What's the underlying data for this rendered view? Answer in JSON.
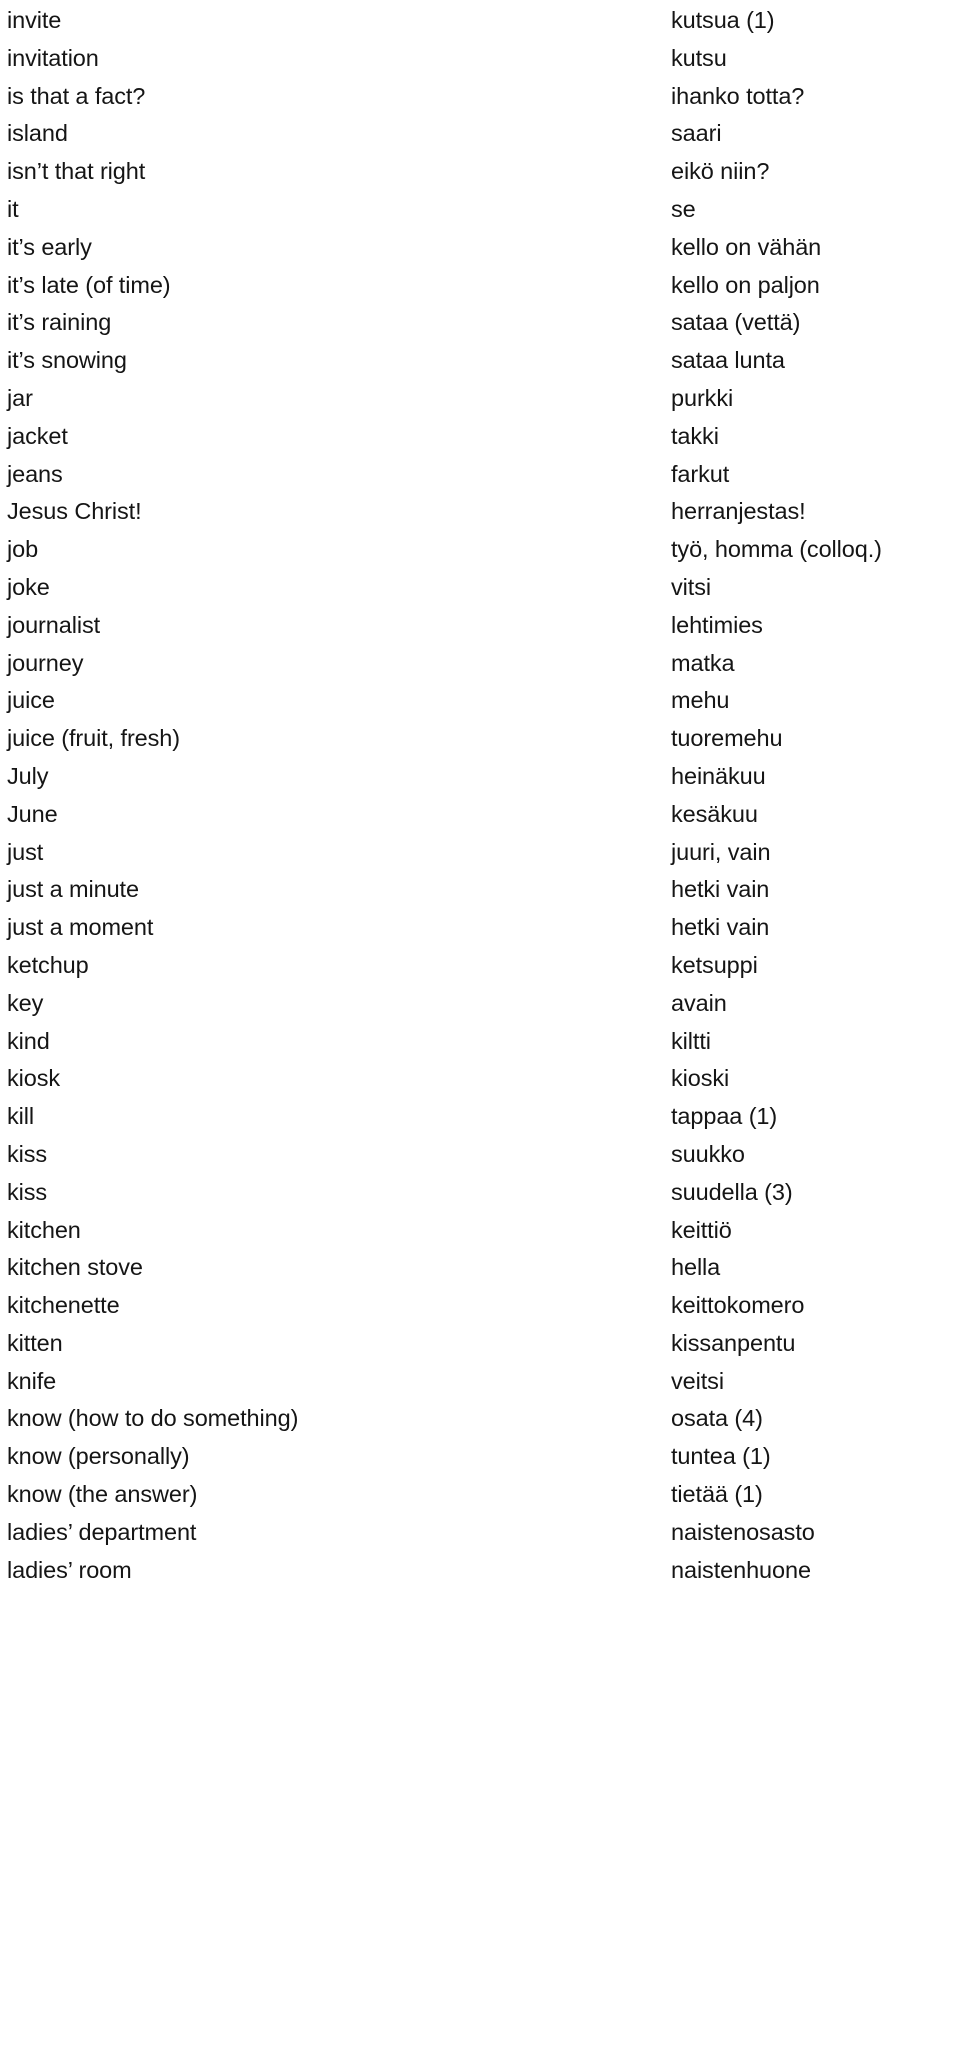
{
  "document": {
    "type": "bilingual-glossary",
    "source_language": "English",
    "target_language": "Finnish",
    "entries": [
      {
        "en": "invite",
        "fi": "kutsua (1)"
      },
      {
        "en": "invitation",
        "fi": "kutsu"
      },
      {
        "en": "is that a fact?",
        "fi": "ihanko totta?"
      },
      {
        "en": "island",
        "fi": "saari"
      },
      {
        "en": "isn’t that right",
        "fi": "eikö niin?"
      },
      {
        "en": "it",
        "fi": "se"
      },
      {
        "en": "it’s early",
        "fi": "kello on vähän"
      },
      {
        "en": "it’s late (of time)",
        "fi": "kello on paljon"
      },
      {
        "en": "it’s raining",
        "fi": "sataa (vettä)"
      },
      {
        "en": "it’s snowing",
        "fi": "sataa lunta"
      },
      {
        "en": "jar",
        "fi": "purkki"
      },
      {
        "en": "jacket",
        "fi": "takki"
      },
      {
        "en": "jeans",
        "fi": "farkut"
      },
      {
        "en": "Jesus Christ!",
        "fi": "herranjestas!"
      },
      {
        "en": "job",
        "fi": "työ, homma (colloq.)"
      },
      {
        "en": "joke",
        "fi": "vitsi"
      },
      {
        "en": "journalist",
        "fi": "lehtimies"
      },
      {
        "en": "journey",
        "fi": "matka"
      },
      {
        "en": "juice",
        "fi": "mehu"
      },
      {
        "en": "juice (fruit, fresh)",
        "fi": "tuoremehu"
      },
      {
        "en": "July",
        "fi": "heinäkuu"
      },
      {
        "en": "June",
        "fi": "kesäkuu"
      },
      {
        "en": "just",
        "fi": "juuri, vain"
      },
      {
        "en": "just a minute",
        "fi": "hetki vain"
      },
      {
        "en": "just a moment",
        "fi": "hetki vain"
      },
      {
        "en": "ketchup",
        "fi": "ketsuppi"
      },
      {
        "en": "key",
        "fi": "avain"
      },
      {
        "en": "kind",
        "fi": "kiltti"
      },
      {
        "en": "kiosk",
        "fi": "kioski"
      },
      {
        "en": "kill",
        "fi": "tappaa (1)"
      },
      {
        "en": "kiss",
        "fi": "suukko"
      },
      {
        "en": "kiss",
        "fi": "suudella (3)"
      },
      {
        "en": "kitchen",
        "fi": "keittiö"
      },
      {
        "en": "kitchen stove",
        "fi": "hella"
      },
      {
        "en": "kitchenette",
        "fi": "keittokomero"
      },
      {
        "en": "kitten",
        "fi": "kissanpentu"
      },
      {
        "en": "knife",
        "fi": "veitsi"
      },
      {
        "en": "know (how to do something)",
        "fi": "osata (4)"
      },
      {
        "en": "know (personally)",
        "fi": "tuntea (1)"
      },
      {
        "en": "know (the answer)",
        "fi": "tietää (1)"
      },
      {
        "en": "ladies’ department",
        "fi": "naistenosasto"
      },
      {
        "en": "ladies’ room",
        "fi": "naistenhuone"
      }
    ]
  },
  "colors": {
    "text": "#151515",
    "background": "#ffffff"
  }
}
